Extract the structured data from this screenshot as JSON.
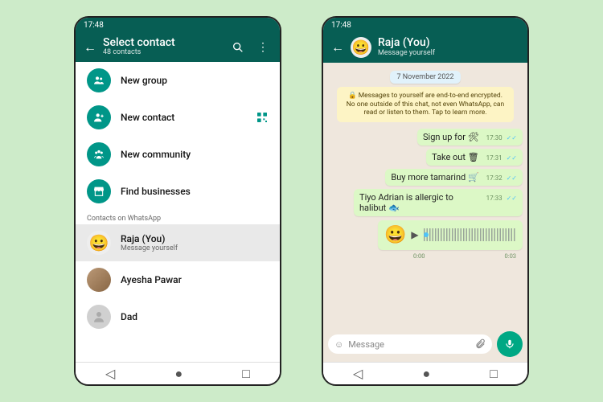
{
  "status_time": "17:48",
  "brand_color": "#075e54",
  "accent_color": "#00a884",
  "phone1": {
    "title": "Select contact",
    "subtitle": "48 contacts",
    "quick": {
      "new_group": "New group",
      "new_contact": "New contact",
      "new_community": "New community",
      "find_businesses": "Find businesses"
    },
    "section_header": "Contacts on WhatsApp",
    "contacts": [
      {
        "name": "Raja (You)",
        "sub": "Message yourself",
        "emoji": "😀",
        "selected": true
      },
      {
        "name": "Ayesha Pawar"
      },
      {
        "name": "Dad"
      }
    ]
  },
  "phone2": {
    "header_name": "Raja (You)",
    "header_sub": "Message yourself",
    "avatar_emoji": "😀",
    "date": "7 November 2022",
    "encryption_notice": "🔒 Messages to yourself are end-to-end encrypted. No one outside of this chat, not even WhatsApp, can read or listen to them. Tap to learn more.",
    "messages": [
      {
        "text": "Sign up for 🛠",
        "time": "17:30"
      },
      {
        "text": "Take out 🗑",
        "time": "17:31"
      },
      {
        "text": "Buy more tamarind 🛒",
        "time": "17:32"
      },
      {
        "text": "Tiyo Adrian is allergic to halibut 🐟",
        "time": "17:33"
      }
    ],
    "voice": {
      "elapsed": "0:00",
      "duration": "0:03"
    },
    "input_placeholder": "Message"
  }
}
